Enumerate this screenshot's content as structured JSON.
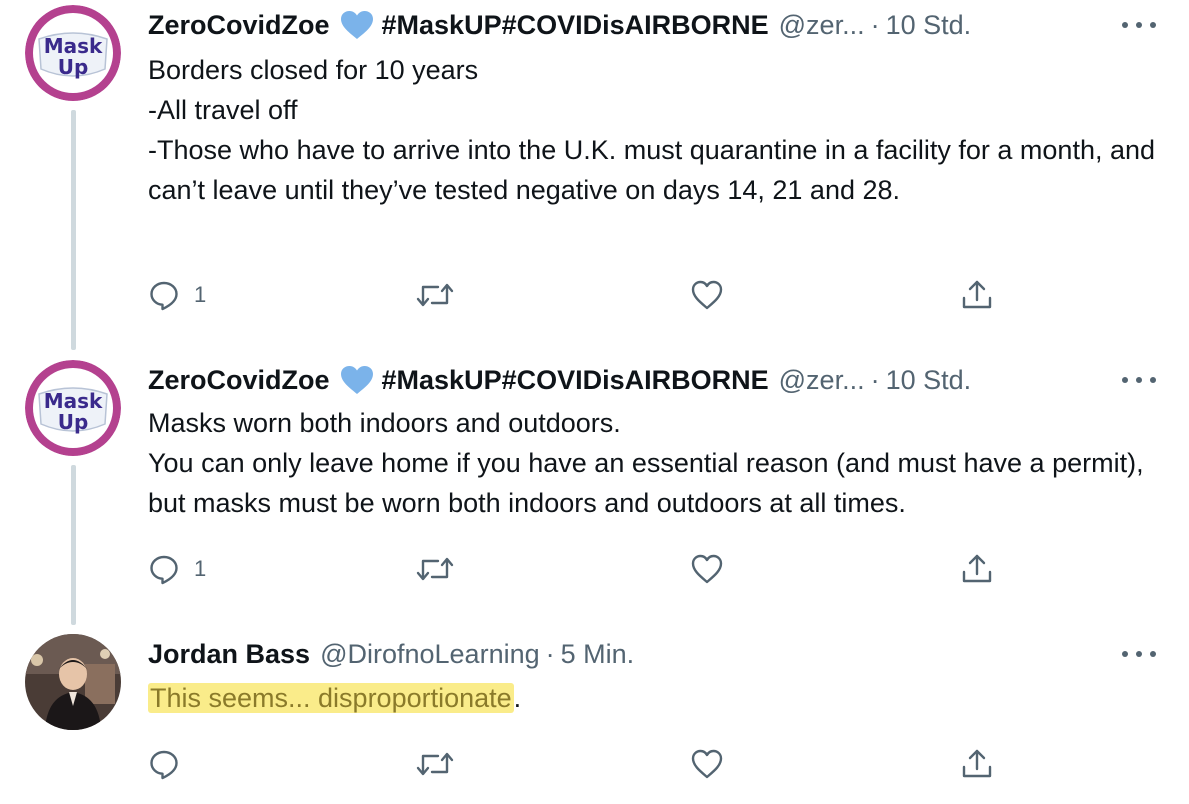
{
  "tweets": [
    {
      "author_name": "ZeroCovidZoe",
      "name_suffix": "#MaskUP#COVIDisAIRBORNE",
      "handle": "@zer...",
      "separator": "·",
      "time": "10 Std.",
      "body": [
        "Borders closed for 10 years",
        "-All travel off",
        "-Those who have to arrive into the U.K. must quarantine in a facility for a month, and can’t leave until they’ve tested negative on days 14, 21 and 28."
      ],
      "reply_count": "1",
      "avatar_text": [
        "Mask",
        "Up"
      ]
    },
    {
      "author_name": "ZeroCovidZoe",
      "name_suffix": "#MaskUP#COVIDisAIRBORNE",
      "handle": "@zer...",
      "separator": "·",
      "time": "10 Std.",
      "body": [
        "Masks worn both indoors and outdoors.",
        "You can only leave home if you have an essential reason (and must have a permit), but masks must be worn both indoors and outdoors at all times."
      ],
      "reply_count": "1",
      "avatar_text": [
        "Mask",
        "Up"
      ]
    },
    {
      "author_name": "Jordan Bass",
      "handle": "@DirofnoLearning",
      "separator": "·",
      "time": "5 Min.",
      "body_highlighted": "This seems... disproportionate",
      "body_trailing": ".",
      "reply_count": ""
    }
  ],
  "colors": {
    "text_primary": "#0f1419",
    "text_secondary": "#536471",
    "heart_emoji": "#7bb3ea",
    "avatar_ring": "#b4418f",
    "avatar_text": "#3a2a8c",
    "highlight": "#faec8a",
    "thread_line": "#cfd9de"
  },
  "icons": {
    "reply": "reply-icon",
    "retweet": "retweet-icon",
    "like": "like-icon",
    "share": "share-icon",
    "more": "more-icon",
    "verified_heart": "blue-heart-emoji"
  }
}
